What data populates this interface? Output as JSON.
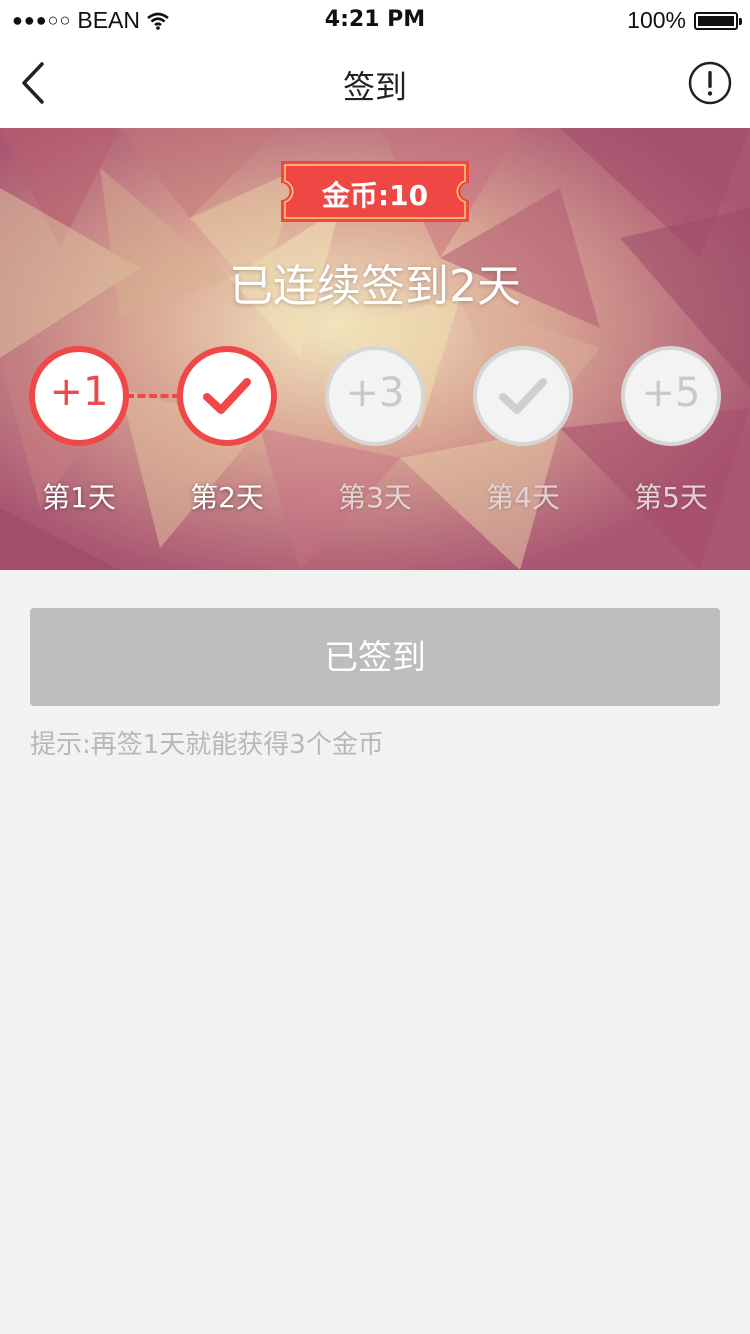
{
  "status_bar": {
    "signal_dots": "●●●○○",
    "carrier": "BEAN",
    "time": "4:21 PM",
    "battery_text": "100%",
    "battery_level": 1.0
  },
  "navbar": {
    "title": "签到",
    "back_icon": "chevron-left-icon",
    "info_icon": "exclamation-circle-icon"
  },
  "banner": {
    "coin_badge": "金币:10",
    "streak_text": "已连续签到2天",
    "days": [
      {
        "label": "第1天",
        "display": "+1",
        "state": "active"
      },
      {
        "label": "第2天",
        "display": "check",
        "state": "active"
      },
      {
        "label": "第3天",
        "display": "+3",
        "state": "inactive"
      },
      {
        "label": "第4天",
        "display": "check",
        "state": "inactive"
      },
      {
        "label": "第5天",
        "display": "+5",
        "state": "inactive"
      }
    ]
  },
  "checkin_button": "已签到",
  "hint": "提示:再签1天就能获得3个金币",
  "colors": {
    "accent": "#f04848",
    "button_disabled": "#bdbdbd",
    "page_bg": "#f2f2f2"
  }
}
